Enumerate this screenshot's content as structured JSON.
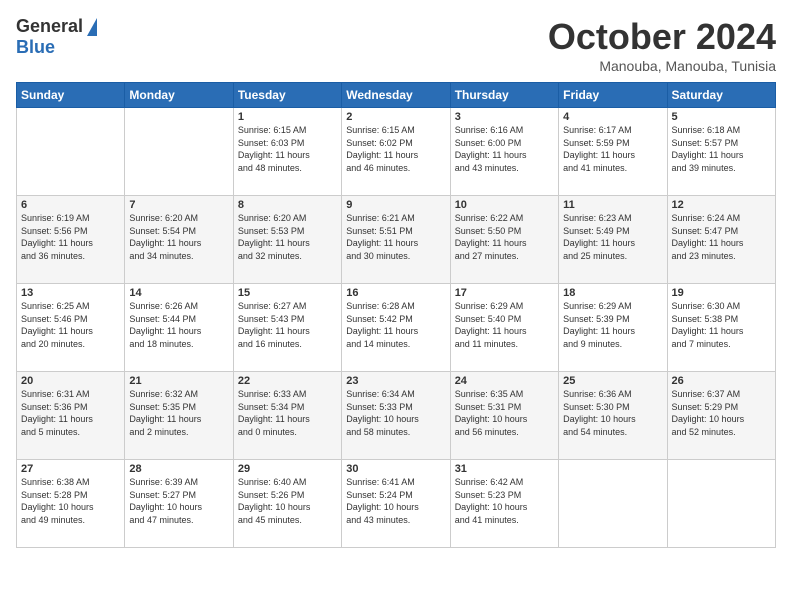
{
  "logo": {
    "general": "General",
    "blue": "Blue"
  },
  "title": "October 2024",
  "location": "Manouba, Manouba, Tunisia",
  "days_of_week": [
    "Sunday",
    "Monday",
    "Tuesday",
    "Wednesday",
    "Thursday",
    "Friday",
    "Saturday"
  ],
  "weeks": [
    [
      {
        "day": "",
        "info": ""
      },
      {
        "day": "",
        "info": ""
      },
      {
        "day": "1",
        "info": "Sunrise: 6:15 AM\nSunset: 6:03 PM\nDaylight: 11 hours\nand 48 minutes."
      },
      {
        "day": "2",
        "info": "Sunrise: 6:15 AM\nSunset: 6:02 PM\nDaylight: 11 hours\nand 46 minutes."
      },
      {
        "day": "3",
        "info": "Sunrise: 6:16 AM\nSunset: 6:00 PM\nDaylight: 11 hours\nand 43 minutes."
      },
      {
        "day": "4",
        "info": "Sunrise: 6:17 AM\nSunset: 5:59 PM\nDaylight: 11 hours\nand 41 minutes."
      },
      {
        "day": "5",
        "info": "Sunrise: 6:18 AM\nSunset: 5:57 PM\nDaylight: 11 hours\nand 39 minutes."
      }
    ],
    [
      {
        "day": "6",
        "info": "Sunrise: 6:19 AM\nSunset: 5:56 PM\nDaylight: 11 hours\nand 36 minutes."
      },
      {
        "day": "7",
        "info": "Sunrise: 6:20 AM\nSunset: 5:54 PM\nDaylight: 11 hours\nand 34 minutes."
      },
      {
        "day": "8",
        "info": "Sunrise: 6:20 AM\nSunset: 5:53 PM\nDaylight: 11 hours\nand 32 minutes."
      },
      {
        "day": "9",
        "info": "Sunrise: 6:21 AM\nSunset: 5:51 PM\nDaylight: 11 hours\nand 30 minutes."
      },
      {
        "day": "10",
        "info": "Sunrise: 6:22 AM\nSunset: 5:50 PM\nDaylight: 11 hours\nand 27 minutes."
      },
      {
        "day": "11",
        "info": "Sunrise: 6:23 AM\nSunset: 5:49 PM\nDaylight: 11 hours\nand 25 minutes."
      },
      {
        "day": "12",
        "info": "Sunrise: 6:24 AM\nSunset: 5:47 PM\nDaylight: 11 hours\nand 23 minutes."
      }
    ],
    [
      {
        "day": "13",
        "info": "Sunrise: 6:25 AM\nSunset: 5:46 PM\nDaylight: 11 hours\nand 20 minutes."
      },
      {
        "day": "14",
        "info": "Sunrise: 6:26 AM\nSunset: 5:44 PM\nDaylight: 11 hours\nand 18 minutes."
      },
      {
        "day": "15",
        "info": "Sunrise: 6:27 AM\nSunset: 5:43 PM\nDaylight: 11 hours\nand 16 minutes."
      },
      {
        "day": "16",
        "info": "Sunrise: 6:28 AM\nSunset: 5:42 PM\nDaylight: 11 hours\nand 14 minutes."
      },
      {
        "day": "17",
        "info": "Sunrise: 6:29 AM\nSunset: 5:40 PM\nDaylight: 11 hours\nand 11 minutes."
      },
      {
        "day": "18",
        "info": "Sunrise: 6:29 AM\nSunset: 5:39 PM\nDaylight: 11 hours\nand 9 minutes."
      },
      {
        "day": "19",
        "info": "Sunrise: 6:30 AM\nSunset: 5:38 PM\nDaylight: 11 hours\nand 7 minutes."
      }
    ],
    [
      {
        "day": "20",
        "info": "Sunrise: 6:31 AM\nSunset: 5:36 PM\nDaylight: 11 hours\nand 5 minutes."
      },
      {
        "day": "21",
        "info": "Sunrise: 6:32 AM\nSunset: 5:35 PM\nDaylight: 11 hours\nand 2 minutes."
      },
      {
        "day": "22",
        "info": "Sunrise: 6:33 AM\nSunset: 5:34 PM\nDaylight: 11 hours\nand 0 minutes."
      },
      {
        "day": "23",
        "info": "Sunrise: 6:34 AM\nSunset: 5:33 PM\nDaylight: 10 hours\nand 58 minutes."
      },
      {
        "day": "24",
        "info": "Sunrise: 6:35 AM\nSunset: 5:31 PM\nDaylight: 10 hours\nand 56 minutes."
      },
      {
        "day": "25",
        "info": "Sunrise: 6:36 AM\nSunset: 5:30 PM\nDaylight: 10 hours\nand 54 minutes."
      },
      {
        "day": "26",
        "info": "Sunrise: 6:37 AM\nSunset: 5:29 PM\nDaylight: 10 hours\nand 52 minutes."
      }
    ],
    [
      {
        "day": "27",
        "info": "Sunrise: 6:38 AM\nSunset: 5:28 PM\nDaylight: 10 hours\nand 49 minutes."
      },
      {
        "day": "28",
        "info": "Sunrise: 6:39 AM\nSunset: 5:27 PM\nDaylight: 10 hours\nand 47 minutes."
      },
      {
        "day": "29",
        "info": "Sunrise: 6:40 AM\nSunset: 5:26 PM\nDaylight: 10 hours\nand 45 minutes."
      },
      {
        "day": "30",
        "info": "Sunrise: 6:41 AM\nSunset: 5:24 PM\nDaylight: 10 hours\nand 43 minutes."
      },
      {
        "day": "31",
        "info": "Sunrise: 6:42 AM\nSunset: 5:23 PM\nDaylight: 10 hours\nand 41 minutes."
      },
      {
        "day": "",
        "info": ""
      },
      {
        "day": "",
        "info": ""
      }
    ]
  ]
}
